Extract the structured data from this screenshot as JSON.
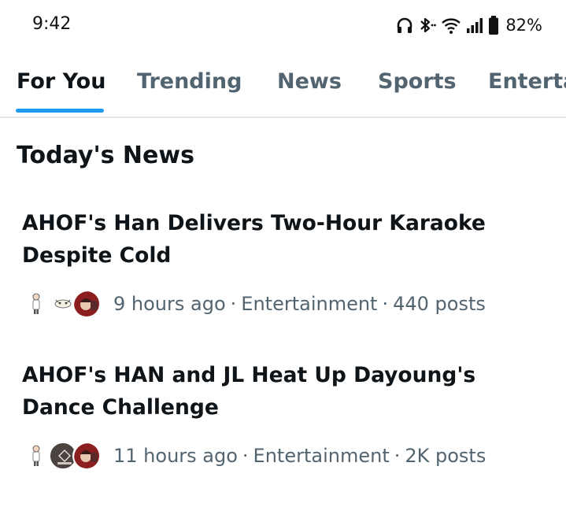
{
  "status_bar": {
    "time": "9:42",
    "battery": "82%",
    "icons": [
      "headphones-icon",
      "bluetooth-icon",
      "wifi-icon",
      "signal-icon",
      "battery-icon"
    ]
  },
  "tabs": [
    {
      "label": "For You",
      "active": true
    },
    {
      "label": "Trending",
      "active": false
    },
    {
      "label": "News",
      "active": false
    },
    {
      "label": "Sports",
      "active": false
    },
    {
      "label": "Entertainment",
      "active": false
    }
  ],
  "accent_color": "#1d9bf0",
  "section": {
    "title": "Today's News",
    "items": [
      {
        "headline": "AHOF's Han Delivers Two-Hour Karaoke Despite Cold",
        "time": "9 hours ago",
        "category": "Entertainment",
        "posts": "440 posts",
        "separator": "·"
      },
      {
        "headline": "AHOF's HAN and JL Heat Up Dayoung's Dance Challenge",
        "time": "11 hours ago",
        "category": "Entertainment",
        "posts": "2K posts",
        "separator": "·"
      }
    ]
  }
}
